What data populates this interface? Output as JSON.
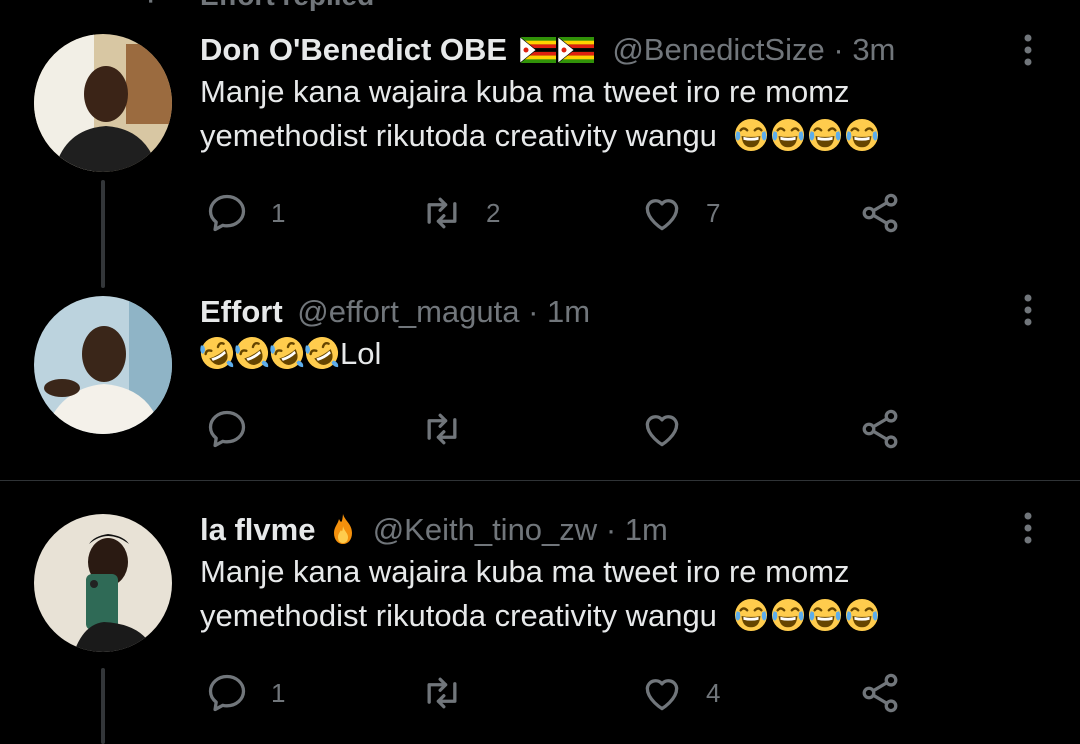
{
  "context": {
    "replied_label": "Effort replied"
  },
  "tweets": [
    {
      "name": "Don O'Benedict OBE",
      "handle": "@BenedictSize",
      "separator": "·",
      "time": "3m",
      "lines": [
        "Manje kana wajaira kuba ma tweet iro re momz",
        "yemethodist rikutoda creativity wangu"
      ],
      "emoji_after": [
        "face-with-tears-of-joy",
        "face-with-tears-of-joy",
        "face-with-tears-of-joy",
        "face-with-tears-of-joy"
      ],
      "name_suffix_icons": [
        "zimbabwe-flag",
        "zimbabwe-flag"
      ],
      "reply_count": "1",
      "retweet_count": "2",
      "like_count": "7"
    },
    {
      "name": "Effort",
      "handle": "@effort_maguta",
      "separator": "·",
      "time": "1m",
      "text_after_emoji": "Lol",
      "emoji_before": [
        "rofl",
        "rofl",
        "rofl",
        "rofl"
      ],
      "reply_count": "",
      "retweet_count": "",
      "like_count": ""
    },
    {
      "name": "la flvme",
      "handle": "@Keith_tino_zw",
      "separator": "·",
      "time": "1m",
      "lines": [
        "Manje kana wajaira kuba ma tweet iro re momz",
        "yemethodist rikutoda creativity wangu"
      ],
      "emoji_after": [
        "face-with-tears-of-joy",
        "face-with-tears-of-joy",
        "face-with-tears-of-joy",
        "face-with-tears-of-joy"
      ],
      "name_suffix_icons": [
        "fire"
      ],
      "reply_count": "1",
      "retweet_count": "",
      "like_count": "4"
    }
  ],
  "colors": {
    "background": "#000000",
    "text": "#e7e9ea",
    "muted": "#71767b",
    "divider": "#2f3336"
  }
}
